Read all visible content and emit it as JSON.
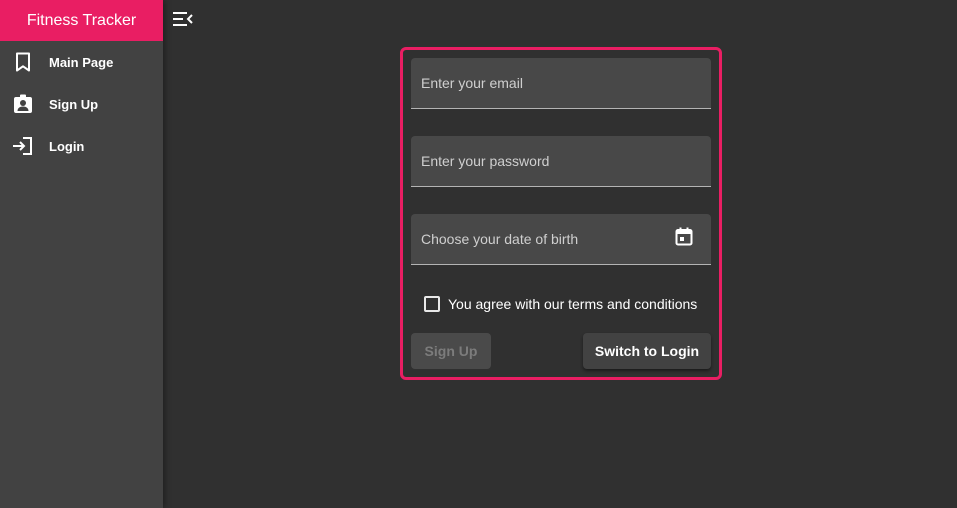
{
  "app": {
    "title": "Fitness Tracker",
    "accent_color": "#e91e63"
  },
  "sidebar": {
    "items": [
      {
        "label": "Main Page",
        "icon": "bookmark-icon"
      },
      {
        "label": "Sign Up",
        "icon": "assignment-ind-icon"
      },
      {
        "label": "Login",
        "icon": "login-icon"
      }
    ]
  },
  "toolbar": {
    "menu_icon": "menu-open-icon"
  },
  "form": {
    "email": {
      "value": "",
      "placeholder": "Enter your email"
    },
    "password": {
      "value": "",
      "placeholder": "Enter your password"
    },
    "dob": {
      "value": "",
      "placeholder": "Choose your date of birth",
      "icon": "calendar-icon"
    },
    "terms_label": "You agree with our terms and conditions",
    "terms_checked": false,
    "signup_label": "Sign Up",
    "signup_disabled": true,
    "switch_label": "Switch to Login"
  }
}
